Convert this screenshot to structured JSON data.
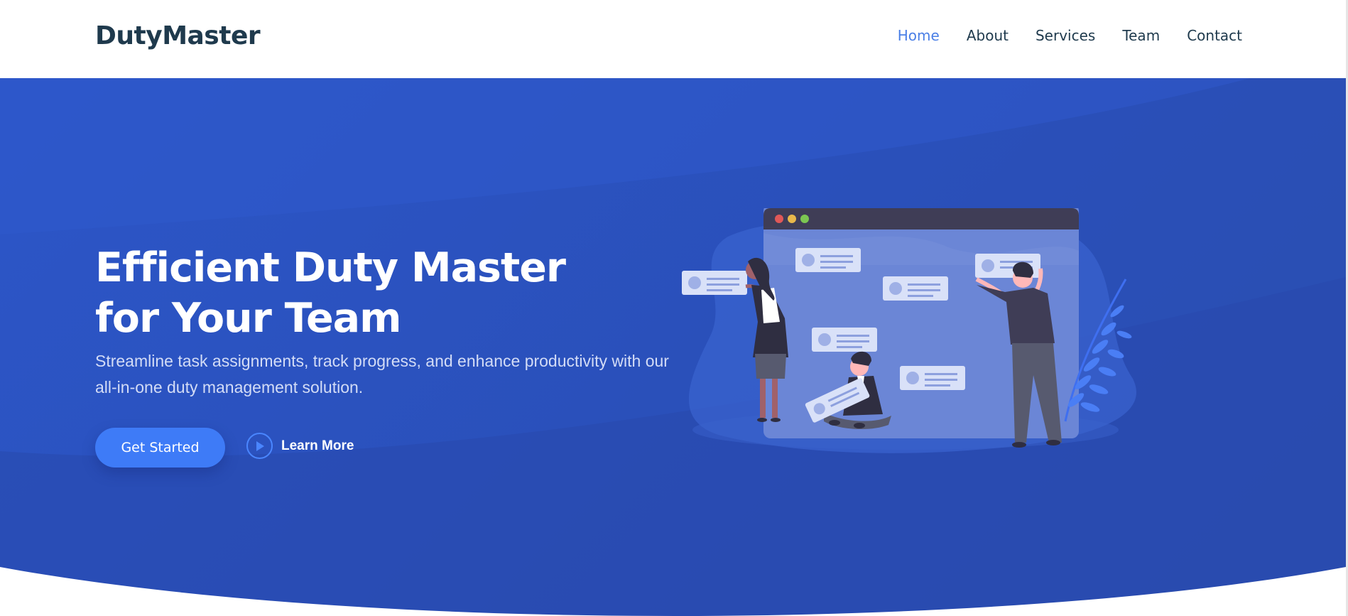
{
  "header": {
    "logo": "DutyMaster",
    "nav": [
      {
        "label": "Home",
        "active": true
      },
      {
        "label": "About",
        "active": false
      },
      {
        "label": "Services",
        "active": false
      },
      {
        "label": "Team",
        "active": false
      },
      {
        "label": "Contact",
        "active": false
      }
    ]
  },
  "hero": {
    "title": "Efficient Duty Master for Your Team",
    "subtitle": "Streamline task assignments, track progress, and enhance productivity with our all-in-one duty management solution.",
    "primary_button": "Get Started",
    "secondary_button": "Learn More"
  },
  "colors": {
    "brand_dark": "#1f3a4d",
    "nav_active": "#4a7fe6",
    "hero_blue": "#2c56c8",
    "button_blue": "#3e7bf7"
  },
  "icons": [
    "play-icon",
    "team-task-board-illustration"
  ]
}
